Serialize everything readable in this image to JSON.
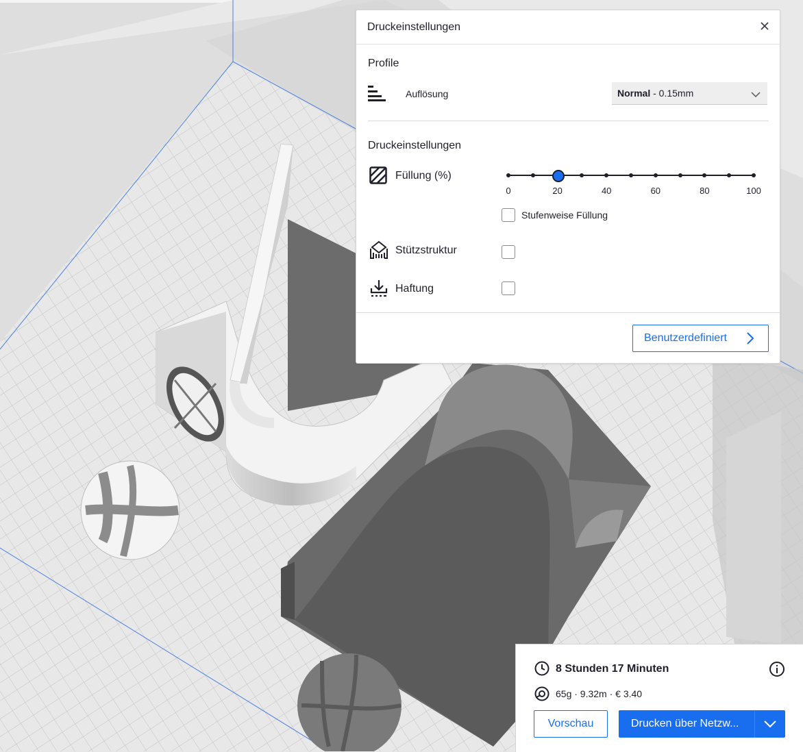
{
  "colors": {
    "accent": "#196ef0",
    "text": "#1f1f2c",
    "panel_bg": "#ffffff",
    "build_plate": "#e6e6e6",
    "model_light": "#f2f2f2",
    "model_dark": "#707070"
  },
  "print_settings": {
    "title": "Druckeinstellungen",
    "close_icon": "close-icon",
    "profiles_heading": "Profile",
    "resolution": {
      "icon": "resolution-bars-icon",
      "label": "Auflösung",
      "value_bold": "Normal",
      "value_rest": " - 0.15mm"
    },
    "settings_heading": "Druckeinstellungen",
    "infill": {
      "icon": "infill-hatch-icon",
      "label": "Füllung (%)",
      "value": 20,
      "tick_labels": [
        "0",
        "20",
        "40",
        "60",
        "80",
        "100"
      ],
      "tick_count": 11
    },
    "gradual_infill": {
      "label": "Stufenweise Füllung",
      "checked": false
    },
    "support": {
      "icon": "support-structure-icon",
      "label": "Stützstruktur",
      "checked": false
    },
    "adhesion": {
      "icon": "adhesion-download-icon",
      "label": "Haftung",
      "checked": false
    },
    "custom_button": "Benutzerdefiniert"
  },
  "job": {
    "time_icon": "clock-icon",
    "print_time": "8 Stunden 17 Minuten",
    "info_icon": "info-icon",
    "stats_icon": "filament-spool-icon",
    "stats": "65g · 9.32m · € 3.40",
    "preview_button": "Vorschau",
    "print_button": "Drucken über Netzw..."
  }
}
